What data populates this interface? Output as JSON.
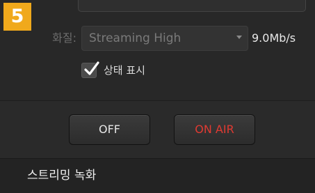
{
  "step_number": "5",
  "streaming": {
    "quality_label": "화질:",
    "quality_value": "Streaming High",
    "bitrate": "9.0Mb/s",
    "show_status_label": "상태 표시",
    "show_status_checked": true
  },
  "buttons": {
    "off_label": "OFF",
    "on_air_label": "ON AIR"
  },
  "section": {
    "title": "스트리밍 녹화"
  },
  "colors": {
    "badge": "#f0a91c",
    "on_air_text": "#e03a32"
  },
  "icons": {
    "dropdown": "chevron-down-icon",
    "checkbox": "checkmark-icon"
  }
}
